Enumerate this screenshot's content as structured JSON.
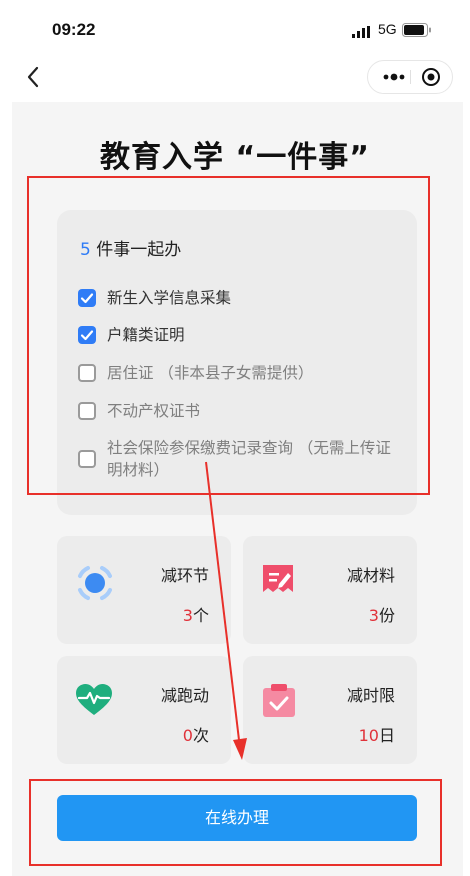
{
  "status": {
    "time": "09:22",
    "network": "5G"
  },
  "page": {
    "title": "教育入学 “一件事”"
  },
  "card": {
    "count": "5",
    "heading": " 件事一起办",
    "items": [
      {
        "label": "新生入学信息采集",
        "checked": true
      },
      {
        "label": "户籍类证明",
        "checked": true
      },
      {
        "label": "居住证 （非本县子女需提供）",
        "checked": false
      },
      {
        "label": "不动产权证书",
        "checked": false
      },
      {
        "label": "社会保险参保缴费记录查询 （无需上传证明材料）",
        "checked": false
      }
    ]
  },
  "stats": [
    {
      "label": "减环节",
      "number": "3",
      "unit": "个",
      "icon": "target-icon"
    },
    {
      "label": "减材料",
      "number": "3",
      "unit": "份",
      "icon": "document-edit-icon"
    },
    {
      "label": "减跑动",
      "number": "0",
      "unit": "次",
      "icon": "heartbeat-icon"
    },
    {
      "label": "减时限",
      "number": "10",
      "unit": "日",
      "icon": "calendar-check-icon"
    }
  ],
  "action": {
    "label": "在线办理"
  },
  "colors": {
    "accent": "#2196f3",
    "check": "#2f7cf6",
    "highlight": "#e8302a",
    "number": "#e0323a"
  }
}
